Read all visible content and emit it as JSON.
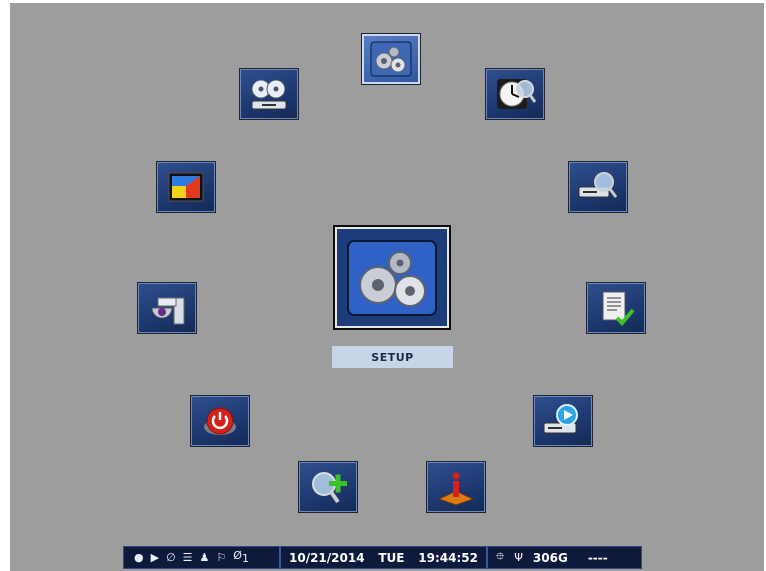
{
  "menu": {
    "center": {
      "label": "SETUP",
      "icon": "setup-gears-icon"
    },
    "items": [
      {
        "id": "setup",
        "icon": "setup-gears-icon",
        "selected": true
      },
      {
        "id": "archive",
        "icon": "disc-archive-icon",
        "selected": false
      },
      {
        "id": "time-search",
        "icon": "clock-search-icon",
        "selected": false
      },
      {
        "id": "display",
        "icon": "monitor-display-icon",
        "selected": false
      },
      {
        "id": "event-search",
        "icon": "hdd-search-icon",
        "selected": false
      },
      {
        "id": "ptz",
        "icon": "dome-camera-icon",
        "selected": false
      },
      {
        "id": "log",
        "icon": "report-check-icon",
        "selected": false
      },
      {
        "id": "shutdown",
        "icon": "power-button-icon",
        "selected": false
      },
      {
        "id": "playback",
        "icon": "hdd-play-icon",
        "selected": false
      },
      {
        "id": "zoom",
        "icon": "zoom-in-icon",
        "selected": false
      },
      {
        "id": "information",
        "icon": "info-icon",
        "selected": false
      }
    ]
  },
  "status_bar": {
    "icons": {
      "record": "●",
      "play": "▶",
      "null": "∅",
      "list": "☰",
      "user": "♟",
      "flag": "⚐",
      "alarm": "Ø",
      "alarm_sub": "1"
    },
    "date": "10/21/2014",
    "day": "TUE",
    "time": "19:44:52",
    "usb1": "⯐",
    "usb2": "Ψ",
    "hdd": "306G",
    "extra": "----"
  },
  "colors": {
    "background": "#9d9d9d",
    "tile": "#1f3a72",
    "label_bg": "#c8d5e8",
    "status_bar": "#0e1a3c"
  }
}
